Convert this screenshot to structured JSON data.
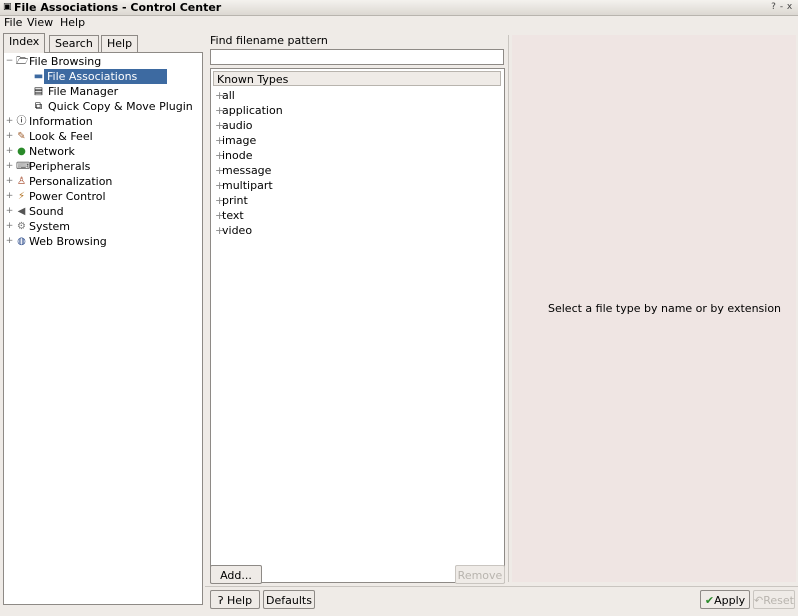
{
  "window": {
    "title": "File Associations - Control Center",
    "app_icon": "kde-icon",
    "controls": [
      "?",
      "-",
      "x"
    ]
  },
  "menubar": {
    "items": [
      {
        "label": "File",
        "mnemonic": "F"
      },
      {
        "label": "View",
        "mnemonic": "V"
      },
      {
        "label": "Help",
        "mnemonic": "H"
      }
    ]
  },
  "tabs": [
    {
      "label": "Index",
      "active": true
    },
    {
      "label": "Search",
      "active": false
    },
    {
      "label": "Help",
      "active": false
    }
  ],
  "tree": [
    {
      "label": "File Browsing",
      "icon": "folder-icon",
      "level": 0,
      "expanded": true
    },
    {
      "label": "File Associations",
      "icon": "associations-icon",
      "level": 1,
      "selected": true
    },
    {
      "label": "File Manager",
      "icon": "filemanager-icon",
      "level": 1
    },
    {
      "label": "Quick Copy & Move Plugin",
      "icon": "copy-icon",
      "level": 1
    },
    {
      "label": "Information",
      "icon": "info-icon",
      "level": 0
    },
    {
      "label": "Look & Feel",
      "icon": "lookfeel-icon",
      "level": 0
    },
    {
      "label": "Network",
      "icon": "network-icon",
      "level": 0
    },
    {
      "label": "Peripherals",
      "icon": "peripherals-icon",
      "level": 0
    },
    {
      "label": "Personalization",
      "icon": "personalization-icon",
      "level": 0
    },
    {
      "label": "Power Control",
      "icon": "power-icon",
      "level": 0
    },
    {
      "label": "Sound",
      "icon": "sound-icon",
      "level": 0
    },
    {
      "label": "System",
      "icon": "system-icon",
      "level": 0
    },
    {
      "label": "Web Browsing",
      "icon": "web-icon",
      "level": 0
    }
  ],
  "find": {
    "label": "Find filename pattern",
    "value": ""
  },
  "known_types": {
    "header": "Known Types",
    "items": [
      "all",
      "application",
      "audio",
      "image",
      "inode",
      "message",
      "multipart",
      "print",
      "text",
      "video"
    ]
  },
  "buttons": {
    "add": "Add...",
    "remove": "Remove",
    "help": "Help",
    "defaults": "Defaults",
    "apply": "Apply",
    "reset": "Reset"
  },
  "right_panel": {
    "message": "Select a file type by name or by extension"
  },
  "colors": {
    "selection": "#3d6aa1",
    "background": "#efebe7"
  }
}
